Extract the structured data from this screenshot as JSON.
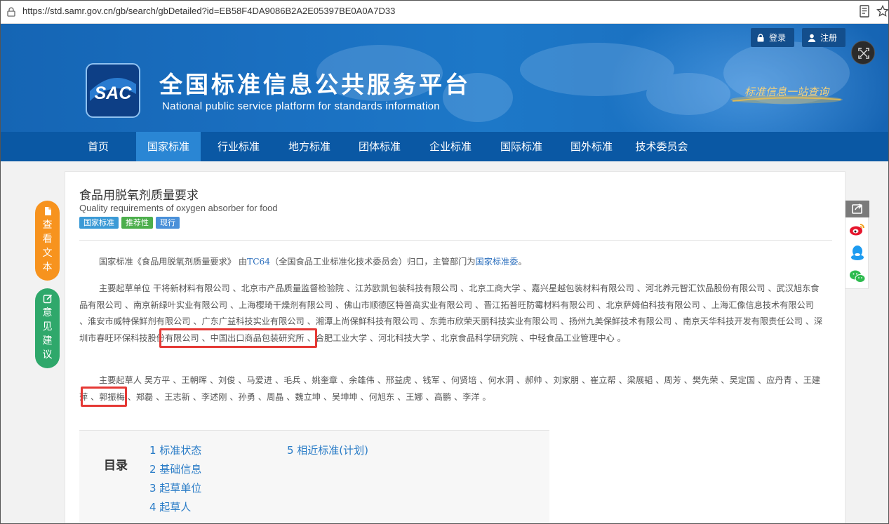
{
  "browser": {
    "url": "https://std.samr.gov.cn/gb/search/gbDetailed?id=EB58F4DA9086B2A2E05397BE0A0A7D33"
  },
  "header": {
    "login": "登录",
    "register": "注册",
    "title_cn": "全国标准信息公共服务平台",
    "title_en": "National public service platform  for standards information",
    "logo_text": "SAC",
    "slogan": "标准信息一站查询"
  },
  "nav": {
    "items": [
      "首页",
      "国家标准",
      "行业标准",
      "地方标准",
      "团体标准",
      "企业标准",
      "国际标准",
      "国外标准",
      "技术委员会"
    ],
    "active": "国家标准"
  },
  "standard": {
    "title": "食品用脱氧剂质量要求",
    "title_en": "Quality requirements of oxygen absorber for food",
    "tags": [
      "国家标准",
      "推荐性",
      "现行"
    ],
    "intro": {
      "p1": "国家标准《食品用脱氧剂质量要求》 由",
      "tc": "TC64",
      "p2": "（全国食品工业标准化技术委员会）归口，主管部门为",
      "dept": "国家标准委",
      "p3": "。"
    },
    "drafting_units": "主要起草单位 干将新材料有限公司 、北京市产品质量监督检验院 、江苏欧凯包装科技有限公司 、北京工商大学 、嘉兴星越包装材料有限公司 、河北养元智汇饮品股份有限公司 、武汉旭东食品有限公司 、南京新绿叶实业有限公司 、上海樱琦干燥剂有限公司 、佛山市顺德区特普高实业有限公司 、晋江拓普旺防霉材料有限公司 、北京萨姆伯科技有限公司 、上海汇像信息技术有限公司 、淮安市威特保鲜剂有限公司 、广东广益科技实业有限公司 、湘潭上尚保鲜科技有限公司 、东莞市欣荣天丽科技实业有限公司 、扬州九美保鲜技术有限公司 、南京天华科技开发有限责任公司 、深圳市春旺环保科技股份有限公司 、中国出口商品包装研究所 、合肥工业大学 、河北科技大学 、北京食品科学研究院 、中轻食品工业管理中心 。",
    "drafters": "主要起草人 吴方平 、王朝晖 、刘俊 、马爱进 、毛兵 、姚奎章 、余雄伟 、邢益虎 、钱军 、何贤培 、何水洞 、郝帅 、刘家朋 、崔立帮 、梁展韬 、周芳 、樊先荣 、吴定国 、应丹青 、王建萍 、郭振梅 、郑磊 、王志新 、李述刚 、孙勇 、周晶 、魏立坤 、吴坤坤 、何旭东 、王娜 、高鹏 、李洋 。"
  },
  "toc": {
    "label": "目录",
    "items": [
      "1 标准状态",
      "2 基础信息",
      "3 起草单位",
      "4 起草人",
      "5 相近标准(计划)"
    ]
  },
  "side": {
    "view_text": [
      "查",
      "看",
      "文",
      "本"
    ],
    "feedback": [
      "意",
      "见",
      "建",
      "议"
    ]
  },
  "colors": {
    "banner": "#1a6fc0",
    "nav": "#0a58a4",
    "nav_active": "#2a86d4",
    "link": "#2a7cc7",
    "highlight": "#e53935",
    "orange": "#f7931e",
    "green": "#2fa86b"
  }
}
